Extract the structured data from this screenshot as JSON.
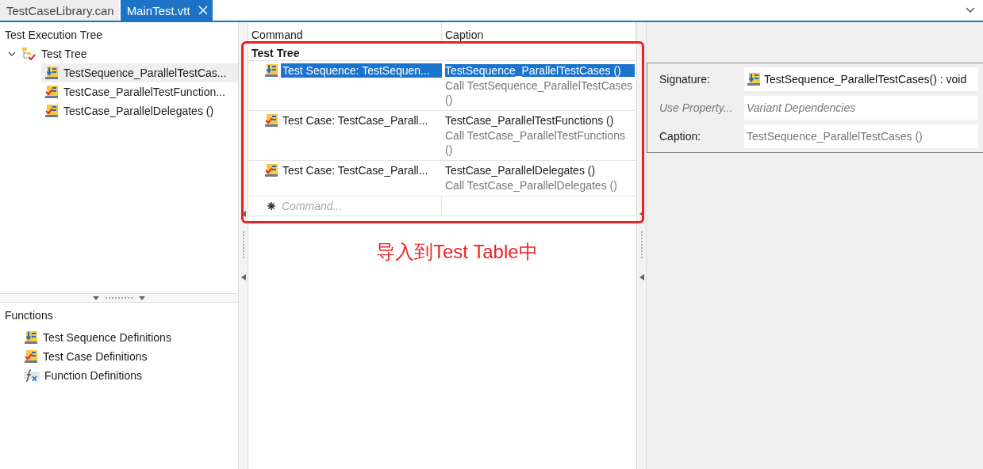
{
  "tabs": [
    {
      "label": "TestCaseLibrary.can",
      "selected": false
    },
    {
      "label": "MainTest.vtt",
      "selected": true
    }
  ],
  "execution_tree": {
    "title": "Test Execution Tree",
    "root": {
      "label": "Test Tree",
      "expanded": true,
      "children": [
        {
          "label": "TestSequence_ParallelTestCas...",
          "kind": "sequence",
          "selected": true
        },
        {
          "label": "TestCase_ParallelTestFunction...",
          "kind": "case",
          "selected": false
        },
        {
          "label": "TestCase_ParallelDelegates ()",
          "kind": "case",
          "selected": false
        }
      ]
    }
  },
  "functions": {
    "title": "Functions",
    "items": [
      {
        "label": "Test Sequence Definitions",
        "kind": "sequence"
      },
      {
        "label": "Test Case Definitions",
        "kind": "case"
      },
      {
        "label": "Function Definitions",
        "kind": "function"
      }
    ]
  },
  "table": {
    "columns": [
      "Command",
      "Caption"
    ],
    "group": "Test Tree",
    "rows": [
      {
        "kind": "sequence",
        "command": "Test Sequence: TestSequen...",
        "caption": "TestSequence_ParallelTestCases ()",
        "call": "Call TestSequence_ParallelTestCases ()",
        "selected": true
      },
      {
        "kind": "case",
        "command": "Test Case: TestCase_Parall...",
        "caption": "TestCase_ParallelTestFunctions ()",
        "call": "Call TestCase_ParallelTestFunctions ()",
        "selected": false
      },
      {
        "kind": "case",
        "command": "Test Case: TestCase_Parall...",
        "caption": "TestCase_ParallelDelegates ()",
        "call": "Call TestCase_ParallelDelegates ()",
        "selected": false
      }
    ],
    "new_row": {
      "placeholder": "Command..."
    }
  },
  "properties": [
    {
      "label": "Signature:",
      "value": "TestSequence_ParallelTestCases() : void",
      "kind": "signature",
      "disabled": false
    },
    {
      "label": "Use Property...",
      "value": "Variant Dependencies",
      "kind": "text",
      "disabled": true
    },
    {
      "label": "Caption:",
      "value": "TestSequence_ParallelTestCases ()",
      "kind": "text",
      "disabled": false
    }
  ],
  "annotation": {
    "text": "导入到Test Table中"
  }
}
